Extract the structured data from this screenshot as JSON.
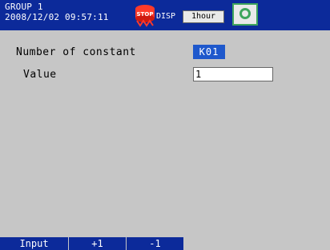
{
  "header": {
    "group": "GROUP 1",
    "datetime": "2008/12/02 09:57:11",
    "disp_label": "DISP",
    "time_range": "1hour",
    "stop_icon": "stop-status-icon",
    "camera_icon": "camera-snapshot-icon"
  },
  "form": {
    "constant_label": "Number of constant",
    "constant_value": "K01",
    "value_label": "Value",
    "value_input": "1"
  },
  "softkeys": [
    "Input",
    "+1",
    "-1"
  ],
  "colors": {
    "header_bg": "#0c2a9a",
    "accent": "#1e58cc",
    "screen_bg": "#c6c6c6"
  }
}
